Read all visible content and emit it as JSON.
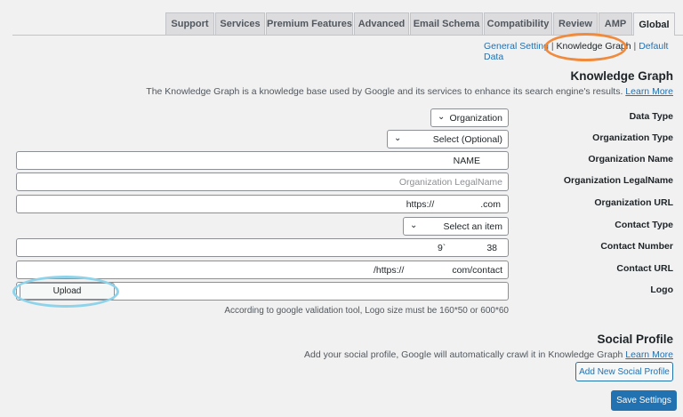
{
  "tabs": [
    {
      "label": "Support"
    },
    {
      "label": "Services"
    },
    {
      "label": "Premium Features"
    },
    {
      "label": "Advanced"
    },
    {
      "label": "Email Schema"
    },
    {
      "label": "Compatibility"
    },
    {
      "label": "Review"
    },
    {
      "label": "AMP"
    },
    {
      "label": "Global",
      "active": true
    }
  ],
  "subnav": {
    "general": "General Setting",
    "sep1": "|",
    "knowledge": "Knowledge Graph",
    "sep2": "|",
    "default": "Default Data"
  },
  "knowledge_graph": {
    "title": "Knowledge Graph",
    "description": "The Knowledge Graph is a knowledge base used by Google and its services to enhance its search engine's results.",
    "learn_more": "Learn More"
  },
  "fields": {
    "data_type": {
      "label": "Data Type",
      "value": "Organization"
    },
    "organization_type": {
      "label": "Organization Type",
      "value": "Select (Optional)"
    },
    "organization_name": {
      "label": "Organization Name",
      "value": "NAME"
    },
    "organization_legalname": {
      "label": "Organization LegalName",
      "placeholder": "Organization LegalName"
    },
    "organization_url": {
      "label": "Organization URL",
      "value_start": "https://",
      "value_end": ".com"
    },
    "contact_type": {
      "label": "Contact Type",
      "value": "Select an item"
    },
    "contact_number": {
      "label": "Contact Number",
      "value_start": "9`",
      "value_end": "38"
    },
    "contact_url": {
      "label": "Contact URL",
      "value_start": "/https://",
      "value_end": "com/contact"
    },
    "logo": {
      "label": "Logo",
      "upload_label": "Upload",
      "hint": "According to google validation tool, Logo size must be 160*50 or 600*60"
    }
  },
  "social_profile": {
    "title": "Social Profile",
    "description": "Add your social profile, Google will automatically crawl it in Knowledge Graph",
    "learn_more": "Learn More",
    "add_button": "Add New Social Profile"
  },
  "save_button": "Save Settings",
  "colors": {
    "accent": "#2271b1",
    "highlight_orange": "#f08a3c",
    "highlight_blue": "#8fd3ea"
  }
}
